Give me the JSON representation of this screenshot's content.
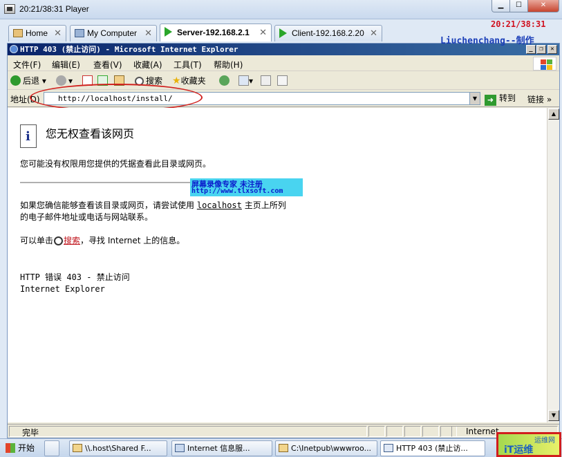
{
  "player": {
    "title": "20:21/38:31 Player",
    "tabs": [
      {
        "label": "Home"
      },
      {
        "label": "My Computer"
      },
      {
        "label": "Server-192.168.2.1"
      },
      {
        "label": "Client-192.168.2.20"
      }
    ],
    "tab_close": "✕",
    "overlay_time": "20:21/38:31"
  },
  "ie": {
    "title": "HTTP 403 (禁止访问) - Microsoft Internet Explorer",
    "credit": "Liuchenchang--制作",
    "menu": [
      "文件(F)",
      "编辑(E)",
      "查看(V)",
      "收藏(A)",
      "工具(T)",
      "帮助(H)"
    ],
    "toolbar": {
      "back": "后退",
      "search": "搜索",
      "favorites": "收藏夹"
    },
    "address": {
      "label": "地址(D)",
      "value": "http://localhost/install/",
      "go": "转到",
      "links": "链接"
    },
    "status": {
      "text": "完毕",
      "zone": "Internet"
    }
  },
  "page": {
    "heading": "您无权查看该网页",
    "para1": "您可能没有权限用您提供的凭据查看此目录或网页。",
    "watermark_line1": "屏幕录像专家      未注册",
    "watermark_line2": "http://www.tlxsoft.com",
    "para2_a": "如果您确信能够查看该目录或网页，请尝试使用",
    "para2_link": "localhost",
    "para2_b": "主页上所列",
    "para2_c": "的电子邮件地址或电话与网站联系。",
    "para3_a": "可以单击",
    "para3_link": "搜索",
    "para3_b": "，寻找 Internet 上的信息。",
    "error_code": "HTTP 错误 403 - 禁止访问",
    "error_source": "Internet Explorer"
  },
  "taskbar": {
    "start": "开始",
    "items": [
      {
        "label": "\\\\.host\\Shared F..."
      },
      {
        "label": "Internet 信息服..."
      },
      {
        "label": "C:\\Inetpub\\wwwroo..."
      },
      {
        "label": "HTTP 403 (禁止访..."
      }
    ],
    "corner_logo": "运维网",
    "corner_text": "iT运维"
  }
}
